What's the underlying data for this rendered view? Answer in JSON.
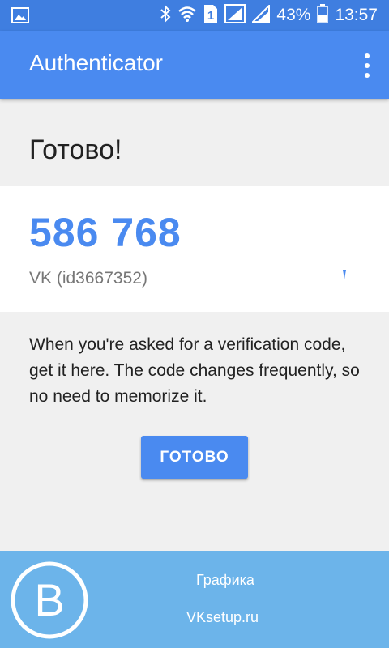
{
  "status_bar": {
    "battery_percent": "43%",
    "time": "13:57",
    "sim_slot": "1",
    "icons": [
      "image-icon",
      "bluetooth-icon",
      "wifi-icon",
      "sim-icon",
      "signal-icon",
      "battery-icon"
    ]
  },
  "app_bar": {
    "title": "Authenticator",
    "menu_icon": "more-vert-icon"
  },
  "main": {
    "heading": "Готово!",
    "code": "586 768",
    "account": "VK (id3667352)",
    "info_text": "When you're asked for a verification code, get it here. The code changes frequently, so no need to memorize it.",
    "done_button": "ГОТОВО"
  },
  "footer": {
    "line1": "Графика",
    "line2": "VKsetup.ru",
    "logo_letter": "B"
  },
  "colors": {
    "status_bar": "#3f7ee0",
    "app_bar": "#4a8af0",
    "accent": "#4a8af0",
    "footer": "#6cb4ea"
  }
}
